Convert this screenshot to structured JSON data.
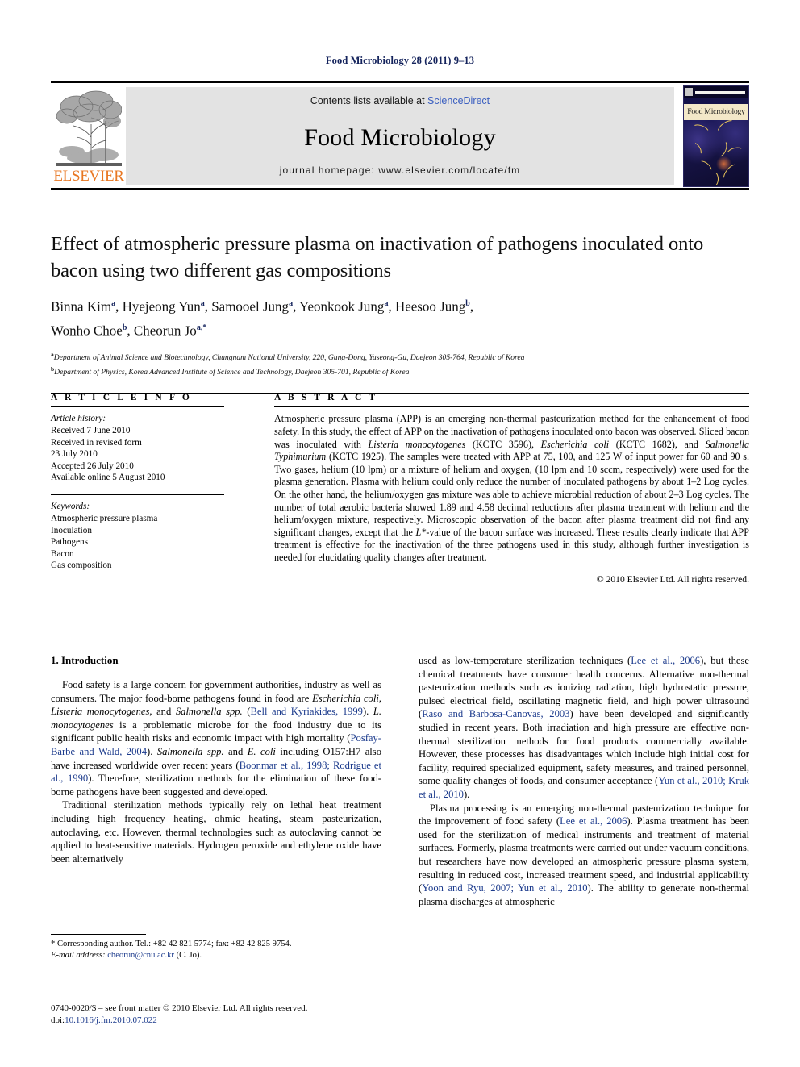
{
  "running_head": "Food Microbiology 28 (2011) 9–13",
  "masthead": {
    "contents_prefix": "Contents lists available at ",
    "contents_link": "ScienceDirect",
    "journal_title": "Food Microbiology",
    "homepage": "journal homepage: www.elsevier.com/locate/fm",
    "publisher_logo_text": "ELSEVIER",
    "cover_band_title": "Food Microbiology"
  },
  "article": {
    "title": "Effect of atmospheric pressure plasma on inactivation of pathogens inoculated onto bacon using two different gas compositions",
    "authors_line1": "Binna Kim a, Hyejeong Yun a, Samooel Jung a, Yeonkook Jung a, Heesoo Jung b,",
    "authors_line2": "Wonho Choe b, Cheorun Jo a,*",
    "authors": [
      {
        "name": "Binna Kim",
        "sup": "a"
      },
      {
        "name": "Hyejeong Yun",
        "sup": "a"
      },
      {
        "name": "Samooel Jung",
        "sup": "a"
      },
      {
        "name": "Yeonkook Jung",
        "sup": "a"
      },
      {
        "name": "Heesoo Jung",
        "sup": "b"
      },
      {
        "name": "Wonho Choe",
        "sup": "b"
      },
      {
        "name": "Cheorun Jo",
        "sup": "a,*"
      }
    ],
    "affiliations": [
      {
        "marker": "a",
        "text": "Department of Animal Science and Biotechnology, Chungnam National University, 220, Gung-Dong, Yuseong-Gu, Daejeon 305-764, Republic of Korea"
      },
      {
        "marker": "b",
        "text": "Department of Physics, Korea Advanced Institute of Science and Technology, Daejeon 305-701, Republic of Korea"
      }
    ]
  },
  "article_info": {
    "heading": "A R T I C L E  I N F O",
    "history_label": "Article history:",
    "history": [
      "Received 7 June 2010",
      "Received in revised form",
      "23 July 2010",
      "Accepted 26 July 2010",
      "Available online 5 August 2010"
    ],
    "keywords_label": "Keywords:",
    "keywords": [
      "Atmospheric pressure plasma",
      "Inoculation",
      "Pathogens",
      "Bacon",
      "Gas composition"
    ]
  },
  "abstract": {
    "heading": "A B S T R A C T",
    "paragraphs": [
      "Atmospheric pressure plasma (APP) is an emerging non-thermal pasteurization method for the enhancement of food safety. In this study, the effect of APP on the inactivation of pathogens inoculated onto bacon was observed. Sliced bacon was inoculated with Listeria monocytogenes (KCTC 3596), Escherichia coli (KCTC 1682), and Salmonella Typhimurium (KCTC 1925). The samples were treated with APP at 75, 100, and 125 W of input power for 60 and 90 s. Two gases, helium (10 lpm) or a mixture of helium and oxygen, (10 lpm and 10 sccm, respectively) were used for the plasma generation. Plasma with helium could only reduce the number of inoculated pathogens by about 1–2 Log cycles. On the other hand, the helium/oxygen gas mixture was able to achieve microbial reduction of about 2–3 Log cycles. The number of total aerobic bacteria showed 1.89 and 4.58 decimal reductions after plasma treatment with helium and the helium/oxygen mixture, respectively. Microscopic observation of the bacon after plasma treatment did not find any significant changes, except that the L*-value of the bacon surface was increased. These results clearly indicate that APP treatment is effective for the inactivation of the three pathogens used in this study, although further investigation is needed for elucidating quality changes after treatment."
    ],
    "copyright": "© 2010 Elsevier Ltd. All rights reserved."
  },
  "body": {
    "section_heading": "1.  Introduction",
    "left_paragraphs": [
      "Food safety is a large concern for government authorities, industry as well as consumers. The major food-borne pathogens found in food are Escherichia coli, Listeria monocytogenes, and Salmonella spp. (Bell and Kyriakides, 1999). L. monocytogenes is a problematic microbe for the food industry due to its significant public health risks and economic impact with high mortality (Posfay-Barbe and Wald, 2004). Salmonella spp. and E. coli including O157:H7 also have increased worldwide over recent years (Boonmar et al., 1998; Rodrigue et al., 1990). Therefore, sterilization methods for the elimination of these food-borne pathogens have been suggested and developed.",
      "Traditional sterilization methods typically rely on lethal heat treatment including high frequency heating, ohmic heating, steam pasteurization, autoclaving, etc. However, thermal technologies such as autoclaving cannot be applied to heat-sensitive materials. Hydrogen peroxide and ethylene oxide have been alternatively"
    ],
    "right_paragraphs": [
      "used as low-temperature sterilization techniques (Lee et al., 2006), but these chemical treatments have consumer health concerns. Alternative non-thermal pasteurization methods such as ionizing radiation, high hydrostatic pressure, pulsed electrical field, oscillating magnetic field, and high power ultrasound (Raso and Barbosa-Canovas, 2003) have been developed and significantly studied in recent years. Both irradiation and high pressure are effective non-thermal sterilization methods for food products commercially available. However, these processes has disadvantages which include high initial cost for facility, required specialized equipment, safety measures, and trained personnel, some quality changes of foods, and consumer acceptance (Yun et al., 2010; Kruk et al., 2010).",
      "Plasma processing is an emerging non-thermal pasteurization technique for the improvement of food safety (Lee et al., 2006). Plasma treatment has been used for the sterilization of medical instruments and treatment of material surfaces. Formerly, plasma treatments were carried out under vacuum conditions, but researchers have now developed an atmospheric pressure plasma system, resulting in reduced cost, increased treatment speed, and industrial applicability (Yoon and Ryu, 2007; Yun et al., 2010). The ability to generate non-thermal plasma discharges at atmospheric"
    ]
  },
  "footnotes": {
    "corresponding": "* Corresponding author. Tel.: +82 42 821 5774; fax: +82 42 825 9754.",
    "email_label": "E-mail address:",
    "email": "cheorun@cnu.ac.kr",
    "email_owner": "(C. Jo)."
  },
  "imprint": {
    "issn_line": "0740-0020/$ – see front matter © 2010 Elsevier Ltd. All rights reserved.",
    "doi_label": "doi:",
    "doi": "10.1016/j.fm.2010.07.022"
  },
  "colors": {
    "running_head": "#14235c",
    "link": "#3b5fc0",
    "reference": "#1b3a8c",
    "elsevier_orange": "#e87722",
    "masthead_panel": "#e3e3e3"
  }
}
